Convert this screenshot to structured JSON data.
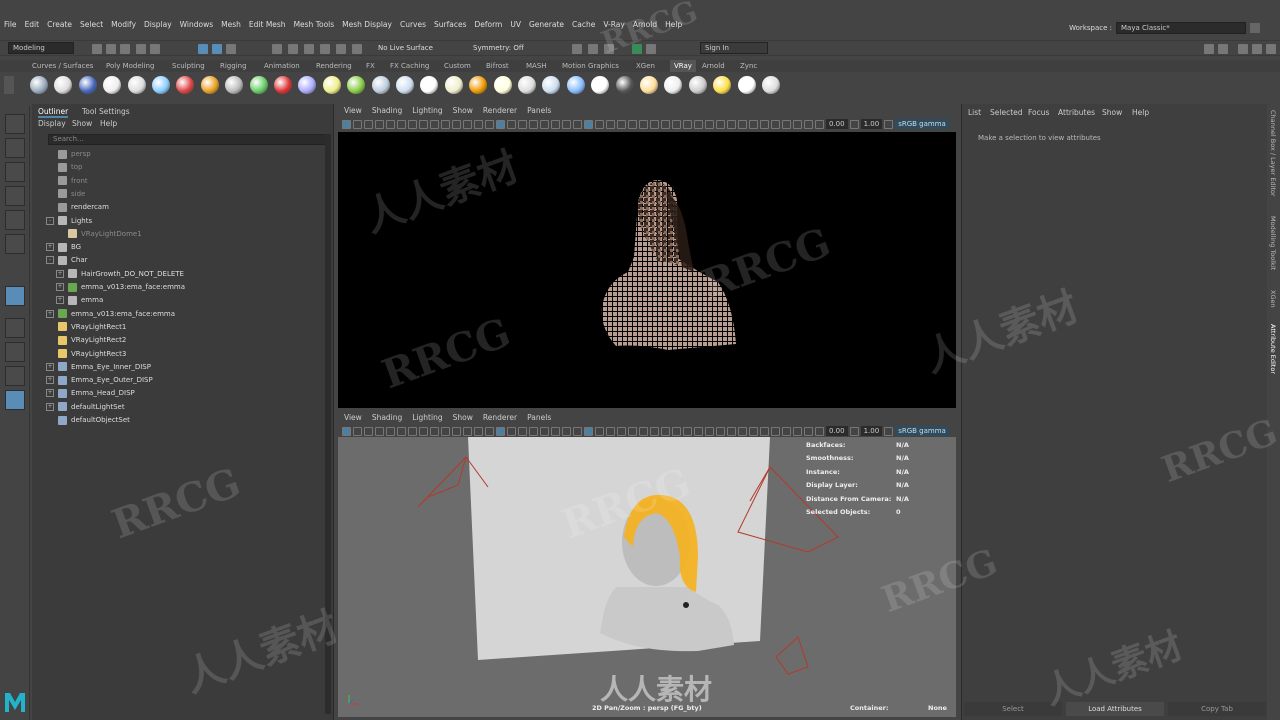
{
  "menubar": {
    "items": [
      "File",
      "Edit",
      "Create",
      "Select",
      "Modify",
      "Display",
      "Windows",
      "Mesh",
      "Edit Mesh",
      "Mesh Tools",
      "Mesh Display",
      "Curves",
      "Surfaces",
      "Deform",
      "UV",
      "Generate",
      "Cache",
      "V-Ray",
      "Arnold",
      "Help"
    ],
    "workspace_label": "Workspace :",
    "workspace_value": "Maya Classic*"
  },
  "status_line": {
    "mode": "Modeling",
    "live_surface": "No Live Surface",
    "symmetry": "Symmetry: Off",
    "sign_in": "Sign In"
  },
  "shelf": {
    "tabs": [
      "Curves / Surfaces",
      "Poly Modeling",
      "Sculpting",
      "Rigging",
      "Animation",
      "Rendering",
      "FX",
      "FX Caching",
      "Custom",
      "Bifrost",
      "MASH",
      "Motion Graphics",
      "XGen",
      "VRay",
      "Arnold",
      "Zync"
    ],
    "active_tab": "VRay",
    "icon_colors": [
      "#9ab",
      "#ddd",
      "#46b",
      "#eee",
      "#ddd",
      "#8cf",
      "#d44",
      "#e8a020",
      "#bbb",
      "#6c6",
      "#d33",
      "#aaf",
      "#ee8",
      "#8c4",
      "#bcd",
      "#cde",
      "#fff",
      "#eec",
      "#e90",
      "#ffd",
      "#ddd",
      "#cde",
      "#8bf",
      "#fff",
      "#555",
      "#fd9",
      "#eee",
      "#ccc",
      "#fd4",
      "#fff",
      "#ddd"
    ]
  },
  "outliner": {
    "tabs": [
      "Outliner",
      "Tool Settings"
    ],
    "menu": [
      "Display",
      "Show",
      "Help"
    ],
    "search_placeholder": "Search...",
    "rows": [
      {
        "label": "persp",
        "indent": 1,
        "icon": "camera-icon",
        "dim": true,
        "expander": ""
      },
      {
        "label": "top",
        "indent": 1,
        "icon": "camera-icon",
        "dim": true,
        "expander": ""
      },
      {
        "label": "front",
        "indent": 1,
        "icon": "camera-icon",
        "dim": true,
        "expander": ""
      },
      {
        "label": "side",
        "indent": 1,
        "icon": "camera-icon",
        "dim": true,
        "expander": ""
      },
      {
        "label": "rendercam",
        "indent": 1,
        "icon": "camera-icon",
        "dim": false,
        "expander": ""
      },
      {
        "label": "Lights",
        "indent": 1,
        "icon": "group-icon",
        "dim": false,
        "expander": "-"
      },
      {
        "label": "VRayLightDome1",
        "indent": 2,
        "icon": "dome-light-icon",
        "dim": true,
        "expander": ""
      },
      {
        "label": "BG",
        "indent": 1,
        "icon": "group-icon",
        "dim": false,
        "expander": "+"
      },
      {
        "label": "Char",
        "indent": 1,
        "icon": "group-icon",
        "dim": false,
        "expander": "-"
      },
      {
        "label": "HairGrowth_DO_NOT_DELETE",
        "indent": 2,
        "icon": "group-icon",
        "dim": false,
        "expander": "+"
      },
      {
        "label": "emma_v013:ema_face:emma",
        "indent": 2,
        "icon": "reference-icon",
        "dim": false,
        "expander": "+"
      },
      {
        "label": "emma",
        "indent": 2,
        "icon": "group-icon",
        "dim": false,
        "expander": "+"
      },
      {
        "label": "emma_v013:ema_face:emma",
        "indent": 1,
        "icon": "reference-icon",
        "dim": false,
        "expander": "+"
      },
      {
        "label": "VRayLightRect1",
        "indent": 1,
        "icon": "rect-light-icon",
        "dim": false,
        "expander": ""
      },
      {
        "label": "VRayLightRect2",
        "indent": 1,
        "icon": "rect-light-icon",
        "dim": false,
        "expander": ""
      },
      {
        "label": "VRayLightRect3",
        "indent": 1,
        "icon": "rect-light-icon",
        "dim": false,
        "expander": ""
      },
      {
        "label": "Emma_Eye_Inner_DISP",
        "indent": 1,
        "icon": "set-icon",
        "dim": false,
        "expander": "+"
      },
      {
        "label": "Emma_Eye_Outer_DISP",
        "indent": 1,
        "icon": "set-icon",
        "dim": false,
        "expander": "+"
      },
      {
        "label": "Emma_Head_DISP",
        "indent": 1,
        "icon": "set-icon",
        "dim": false,
        "expander": "+"
      },
      {
        "label": "defaultLightSet",
        "indent": 1,
        "icon": "set-icon",
        "dim": false,
        "expander": "+"
      },
      {
        "label": "defaultObjectSet",
        "indent": 1,
        "icon": "set-icon",
        "dim": false,
        "expander": ""
      }
    ]
  },
  "viewport_top": {
    "menu": [
      "View",
      "Shading",
      "Lighting",
      "Show",
      "Renderer",
      "Panels"
    ],
    "value_a": "0.00",
    "value_b": "1.00",
    "colorspace": "sRGB gamma"
  },
  "viewport_bottom": {
    "menu": [
      "View",
      "Shading",
      "Lighting",
      "Show",
      "Renderer",
      "Panels"
    ],
    "value_a": "0.00",
    "value_b": "1.00",
    "colorspace": "sRGB gamma",
    "hud": [
      {
        "label": "Backfaces:",
        "value": "N/A"
      },
      {
        "label": "Smoothness:",
        "value": "N/A"
      },
      {
        "label": "Instance:",
        "value": "N/A"
      },
      {
        "label": "Display Layer:",
        "value": "N/A"
      },
      {
        "label": "Distance From Camera:",
        "value": "N/A"
      },
      {
        "label": "Selected Objects:",
        "value": "0"
      }
    ],
    "camera_label": "2D Pan/Zoom : persp (FG_bty)",
    "container_label": "Container:",
    "container_value": "None"
  },
  "attribute_editor": {
    "menu": [
      "List",
      "Selected",
      "Focus",
      "Attributes",
      "Show",
      "Help"
    ],
    "message": "Make a selection to view attributes",
    "buttons": [
      "Select",
      "Load Attributes",
      "Copy Tab"
    ]
  },
  "side_tabs": [
    "Channel Box / Layer Editor",
    "Modelling Toolkit",
    "XGen",
    "Attribute Editor"
  ],
  "watermarks": [
    "RRCG",
    "人人素材"
  ],
  "colors": {
    "accent": "#5285a6",
    "hair": "#f5b21e",
    "frame_lines": "#b23a2a"
  }
}
